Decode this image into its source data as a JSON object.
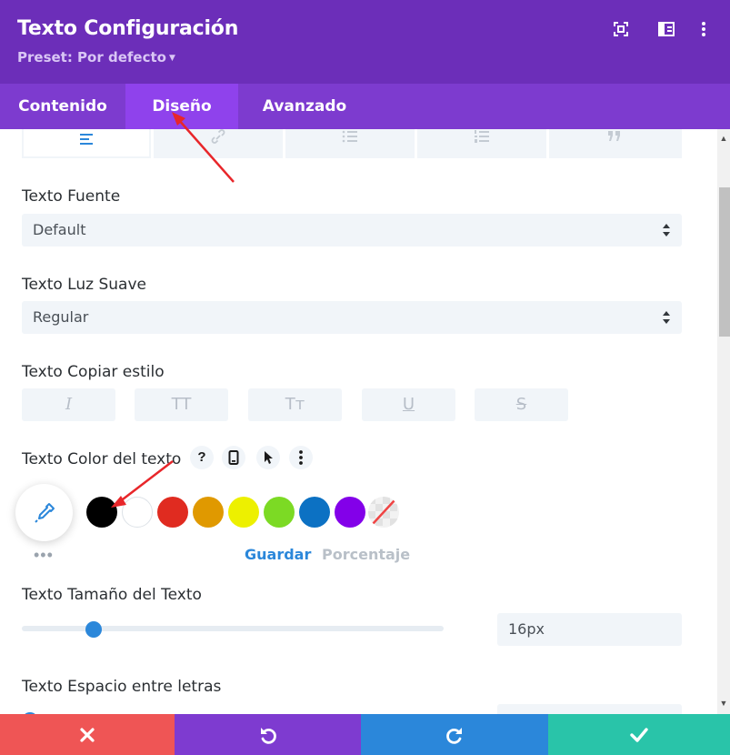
{
  "header": {
    "title": "Texto Configuración",
    "preset_label": "Preset: Por defecto",
    "actions": [
      {
        "name": "expand-icon"
      },
      {
        "name": "sidebar-layout-icon"
      },
      {
        "name": "more-vertical-icon"
      }
    ]
  },
  "tabs": [
    {
      "label": "Contenido",
      "active": false
    },
    {
      "label": "Diseño",
      "active": true
    },
    {
      "label": "Avanzado",
      "active": false
    }
  ],
  "subtabs": [
    {
      "icon": "align-left-icon",
      "active": true
    },
    {
      "icon": "link-icon",
      "active": false
    },
    {
      "icon": "unordered-list-icon",
      "active": false
    },
    {
      "icon": "ordered-list-icon",
      "active": false
    },
    {
      "icon": "quote-icon",
      "active": false
    }
  ],
  "fields": {
    "font": {
      "label": "Texto Fuente",
      "value": "Default"
    },
    "weight": {
      "label": "Texto Luz Suave",
      "value": "Regular"
    },
    "style": {
      "label": "Texto Copiar estilo",
      "buttons": [
        {
          "glyph": "I",
          "icon": "italic-icon"
        },
        {
          "glyph": "TT",
          "icon": "uppercase-icon"
        },
        {
          "glyph": "Tт",
          "icon": "capitalize-icon"
        },
        {
          "glyph": "U",
          "icon": "underline-icon"
        },
        {
          "glyph": "S",
          "icon": "strikethrough-icon"
        }
      ]
    },
    "color": {
      "label": "Texto Color del texto",
      "help": "?",
      "save_label": "Guardar",
      "percent_label": "Porcentaje",
      "swatches": [
        "#000000",
        "#ffffff",
        "#e02b20",
        "#e09900",
        "#edf000",
        "#7cda24",
        "#0c71c3",
        "#8300e9"
      ]
    },
    "size": {
      "label": "Texto Tamaño del Texto",
      "value": "16px",
      "slider_fraction": 0.17
    },
    "spacing": {
      "label": "Texto Espacio entre letras"
    }
  },
  "footer": {
    "buttons": [
      {
        "name": "discard-button",
        "icon": "close-icon",
        "color": "#ef5555"
      },
      {
        "name": "undo-button",
        "icon": "undo-icon",
        "color": "#7e3bd0"
      },
      {
        "name": "redo-button",
        "icon": "redo-icon",
        "color": "#2b87da"
      },
      {
        "name": "save-button",
        "icon": "check-icon",
        "color": "#29c4a9"
      }
    ]
  },
  "colors": {
    "header_bg": "#6c2eb9",
    "tabs_bg": "#7d3bcf",
    "tab_active_bg": "#8f42ec",
    "accent_blue": "#2b87da",
    "annotation_arrow": "#e8262a"
  }
}
